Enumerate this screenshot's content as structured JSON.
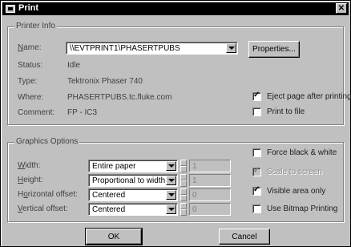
{
  "window": {
    "title": "Print",
    "close_icon": "close-icon"
  },
  "printer_info": {
    "title": "Printer Info",
    "name_label": "Name:",
    "name_value": "\\\\EVTPRINT1\\PHASERTPUBS",
    "properties_label": "Properties...",
    "status_label": "Status:",
    "status_value": "Idle",
    "type_label": "Type:",
    "type_value": "Tektronix Phaser 740",
    "where_label": "Where:",
    "where_value": "PHASERTPUBS.tc.fluke.com",
    "comment_label": "Comment:",
    "comment_value": "FP - IC3",
    "eject_label": "Eject page after printing",
    "eject_checked": true,
    "print_to_file_label": "Print to file",
    "print_to_file_checked": false
  },
  "graphics_options": {
    "title": "Graphics Options",
    "width_label": "Width:",
    "width_value": "Entire paper",
    "width_num": "1",
    "height_label": "Height:",
    "height_value": "Proportional to width",
    "height_num": "1",
    "hoffset_label": "Horizontal offset:",
    "hoffset_value": "Centered",
    "hoffset_num": "0",
    "voffset_label": "Vertical offset:",
    "voffset_value": "Centered",
    "voffset_num": "0",
    "force_bw_label": "Force black & white",
    "force_bw_checked": false,
    "scale_label": "Scale to screen",
    "scale_checked": true,
    "visible_area_label": "Visible area only",
    "visible_area_checked": true,
    "bitmap_label": "Use Bitmap Printing",
    "bitmap_checked": false
  },
  "buttons": {
    "ok": "OK",
    "cancel": "Cancel"
  }
}
